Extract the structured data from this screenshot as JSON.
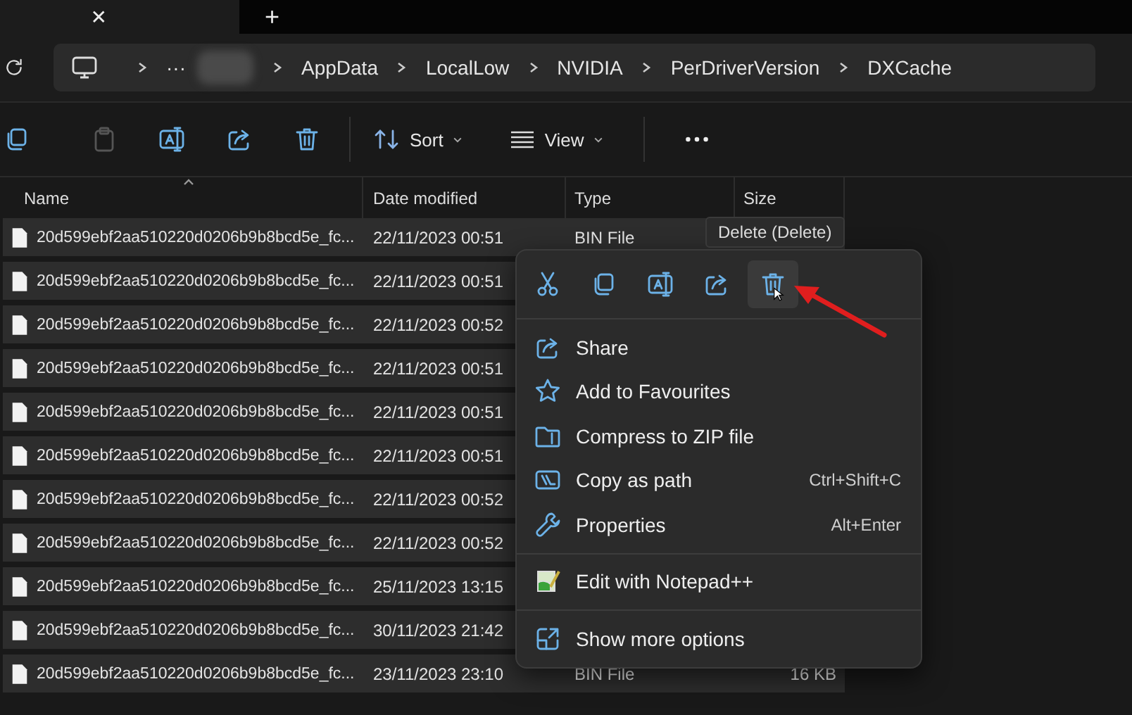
{
  "tab_strip": {
    "close_glyph": "✕",
    "new_tab_glyph": "+"
  },
  "address_bar": {
    "ellipsis": "···",
    "crumbs": [
      "AppData",
      "LocalLow",
      "NVIDIA",
      "PerDriverVersion",
      "DXCache"
    ]
  },
  "toolbar": {
    "icon_buttons": [
      {
        "kind": "copy",
        "disabled": false
      },
      {
        "kind": "paste",
        "disabled": true
      },
      {
        "kind": "rename",
        "disabled": false
      },
      {
        "kind": "share",
        "disabled": false
      },
      {
        "kind": "delete",
        "disabled": false
      }
    ],
    "sort": {
      "label": "Sort"
    },
    "view": {
      "label": "View"
    }
  },
  "table": {
    "columns": [
      {
        "label": "Name",
        "sorted": true
      },
      {
        "label": "Date modified",
        "sorted": false
      },
      {
        "label": "Type",
        "sorted": false
      },
      {
        "label": "Size",
        "sorted": false
      }
    ],
    "rows": [
      {
        "name": "20d599ebf2aa510220d0206b9b8bcd5e_fc...",
        "date": "22/11/2023 00:51",
        "type": "BIN File",
        "selected": true
      },
      {
        "name": "20d599ebf2aa510220d0206b9b8bcd5e_fc...",
        "date": "22/11/2023 00:51",
        "selected": true
      },
      {
        "name": "20d599ebf2aa510220d0206b9b8bcd5e_fc...",
        "date": "22/11/2023 00:52",
        "selected": true
      },
      {
        "name": "20d599ebf2aa510220d0206b9b8bcd5e_fc...",
        "date": "22/11/2023 00:51",
        "selected": true
      },
      {
        "name": "20d599ebf2aa510220d0206b9b8bcd5e_fc...",
        "date": "22/11/2023 00:51",
        "selected": true
      },
      {
        "name": "20d599ebf2aa510220d0206b9b8bcd5e_fc...",
        "date": "22/11/2023 00:51",
        "selected": true
      },
      {
        "name": "20d599ebf2aa510220d0206b9b8bcd5e_fc...",
        "date": "22/11/2023 00:52",
        "selected": true
      },
      {
        "name": "20d599ebf2aa510220d0206b9b8bcd5e_fc...",
        "date": "22/11/2023 00:52",
        "selected": true
      },
      {
        "name": "20d599ebf2aa510220d0206b9b8bcd5e_fc...",
        "date": "25/11/2023 13:15",
        "selected": true
      },
      {
        "name": "20d599ebf2aa510220d0206b9b8bcd5e_fc...",
        "date": "30/11/2023 21:42",
        "selected": true
      },
      {
        "name": "20d599ebf2aa510220d0206b9b8bcd5e_fc...",
        "date": "23/11/2023 23:10",
        "type": "BIN File",
        "size": "16 KB",
        "selected": true
      }
    ]
  },
  "context_menu": {
    "icon_buttons": [
      {
        "kind": "cut",
        "hovered": false
      },
      {
        "kind": "copy",
        "hovered": false
      },
      {
        "kind": "rename",
        "hovered": false
      },
      {
        "kind": "share",
        "hovered": false
      },
      {
        "kind": "delete",
        "hovered": true
      }
    ],
    "tooltip": "Delete (Delete)",
    "sections": [
      [
        {
          "kind": "share",
          "label": "Share"
        },
        {
          "kind": "star",
          "label": "Add to Favourites"
        },
        {
          "kind": "zip",
          "label": "Compress to ZIP file"
        },
        {
          "kind": "path",
          "label": "Copy as path",
          "shortcut": "Ctrl+Shift+C"
        },
        {
          "kind": "wrench",
          "label": "Properties",
          "shortcut": "Alt+Enter"
        }
      ],
      [
        {
          "kind": "notepad",
          "label": "Edit with Notepad++"
        }
      ],
      [
        {
          "kind": "more",
          "label": "Show more options"
        }
      ]
    ]
  }
}
